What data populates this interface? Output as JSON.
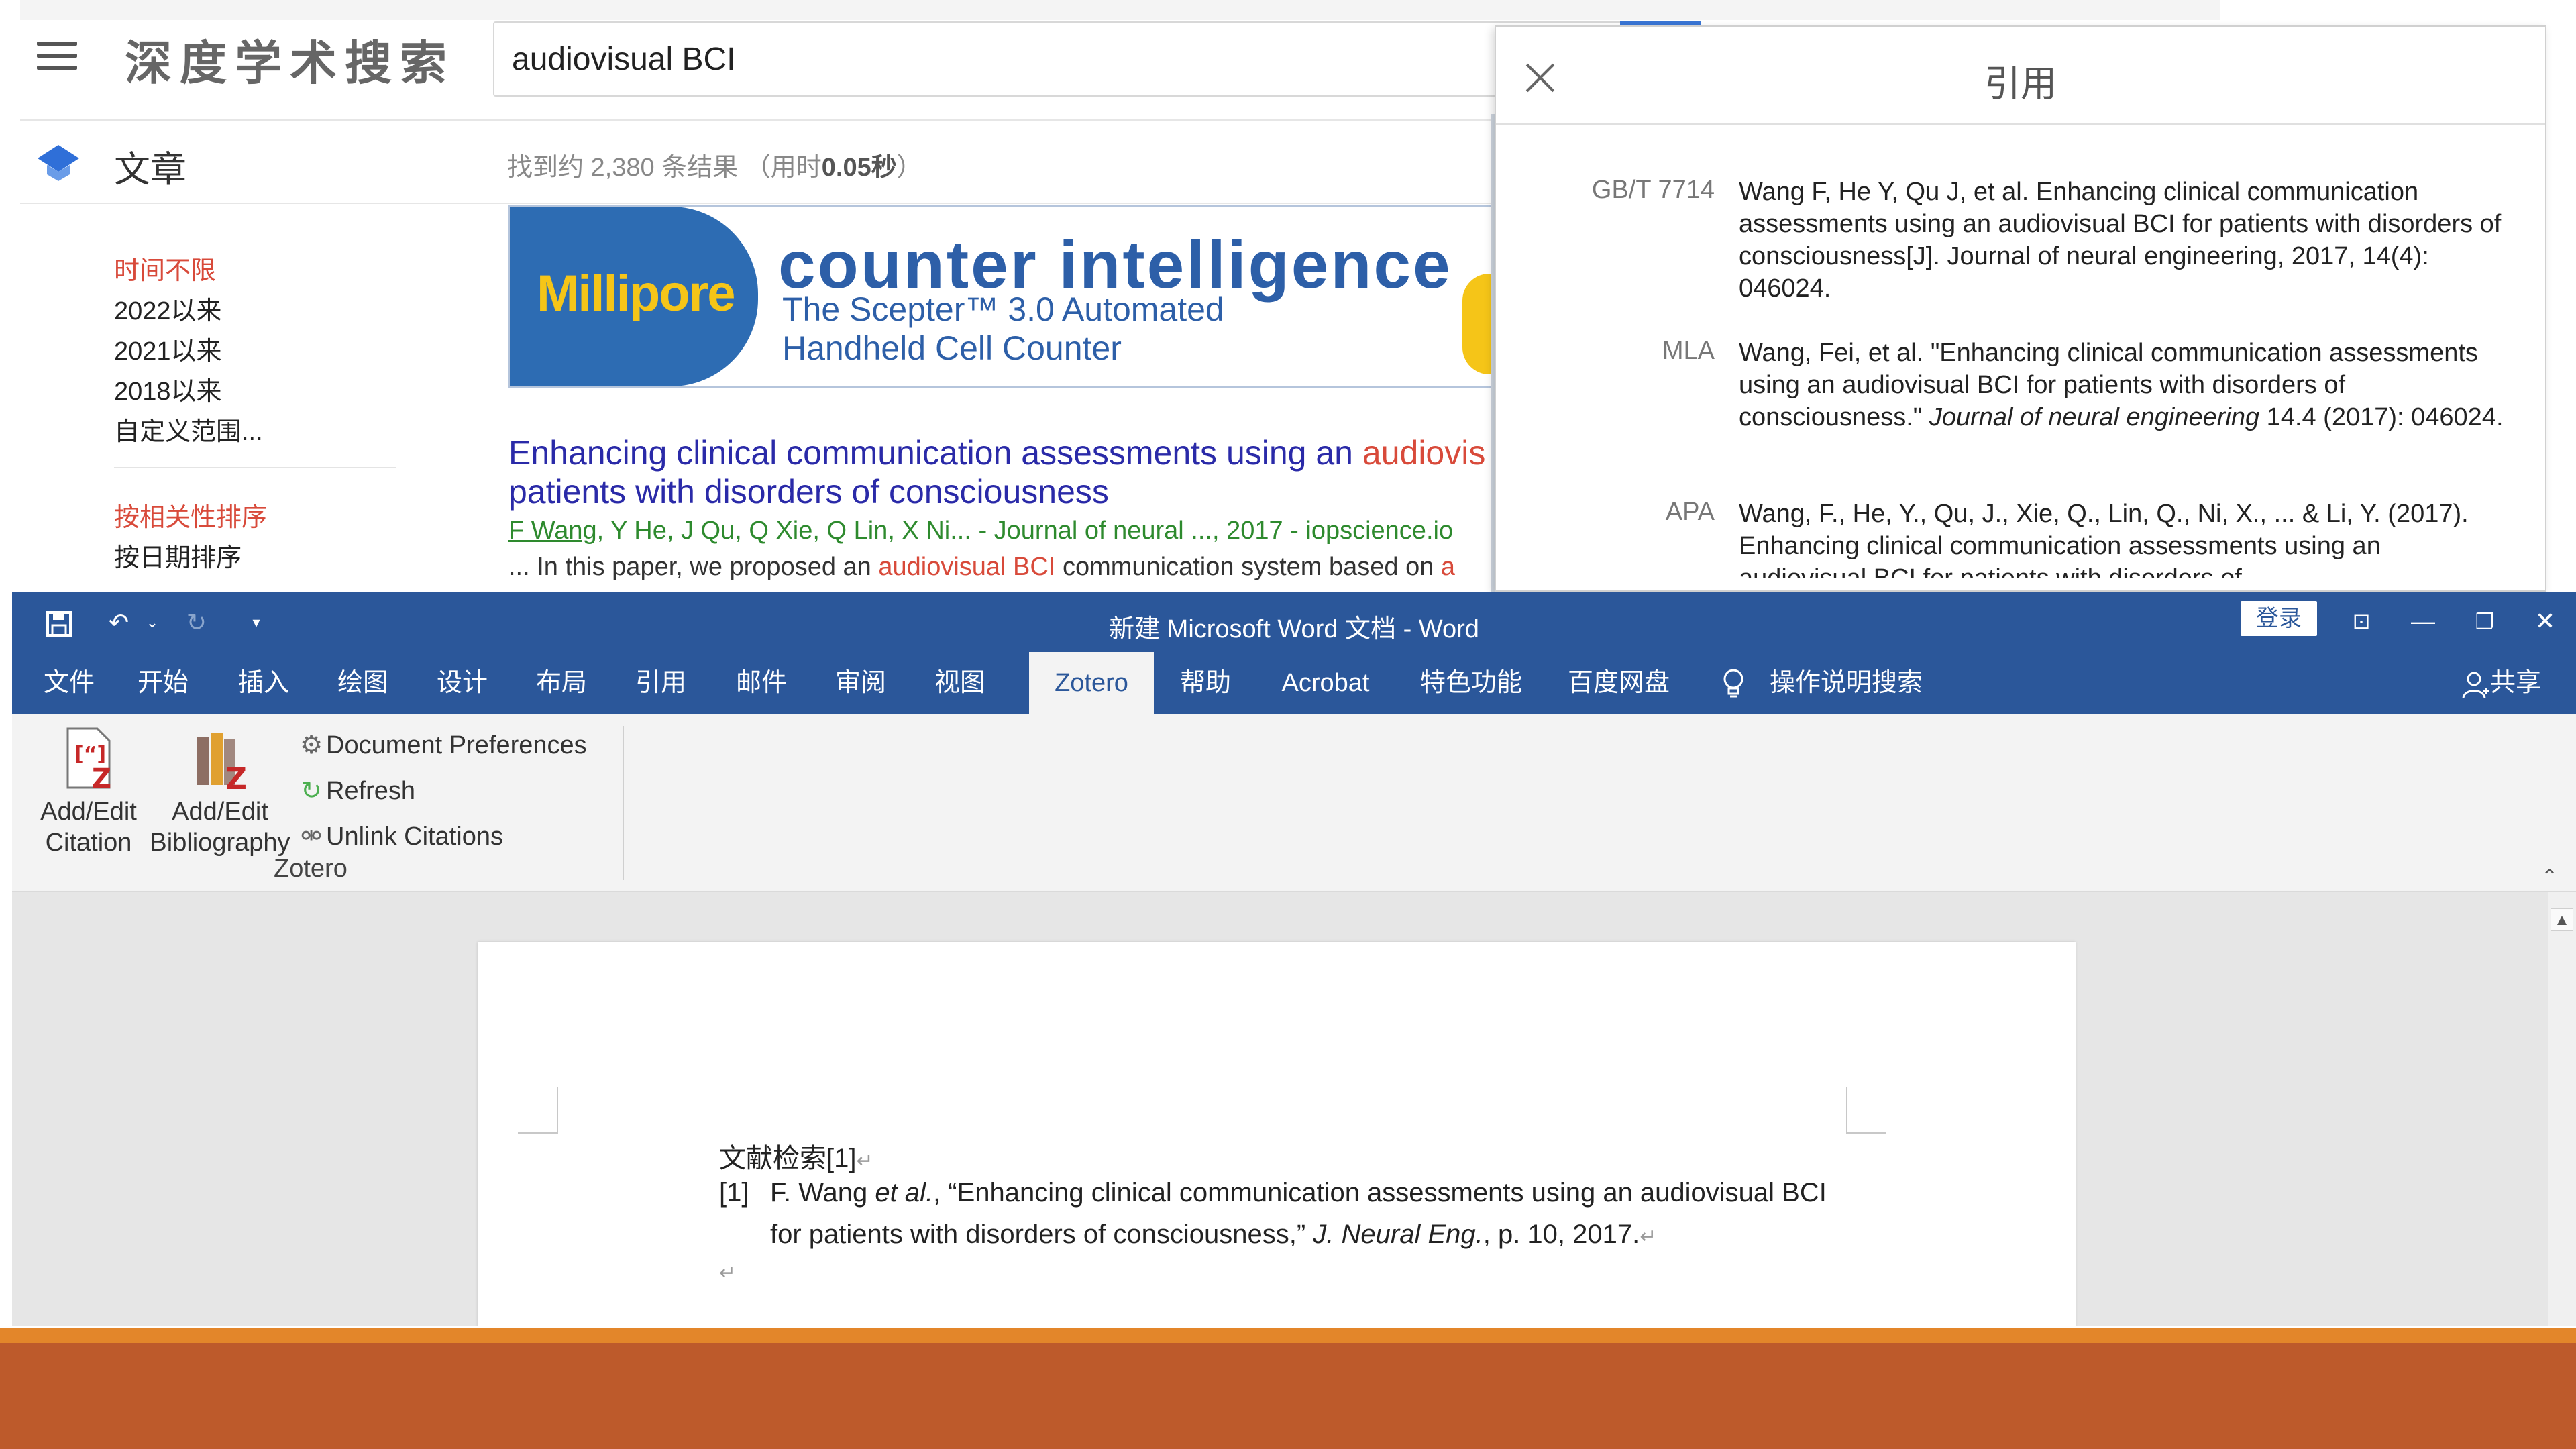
{
  "baidu": {
    "logo": "深度学术搜索",
    "search_value": "audiovisual BCI",
    "tab_article": "文章",
    "result_count_prefix": "找到约 2,380 条结果 （用时",
    "result_time": "0.05秒",
    "result_count_suffix": "）",
    "time_filters": [
      "时间不限",
      "2022以来",
      "2021以来",
      "2018以来",
      "自定义范围..."
    ],
    "sort_options": [
      "按相关性排序",
      "按日期排序"
    ],
    "ad": {
      "brand": "Millipore",
      "title": "counter intelligence",
      "subtitle_1": "The Scepter™ 3.0 Automated",
      "subtitle_2": "Handheld Cell Counter"
    },
    "result": {
      "title_part1": "Enhancing clinical communication assessments using an ",
      "title_highlight": "audiovis",
      "title_part2": "patients with disorders of consciousness",
      "meta_author": "F Wang",
      "meta_rest": ", Y He, J Qu, Q Xie, Q Lin, X Ni... - Journal of neural ..., 2017 - iopscience.io",
      "snippet_part1": "... In this paper, we proposed an ",
      "snippet_highlight": "audiovisual BCI",
      "snippet_part2": " communication system based on ",
      "snippet_tail": "a"
    },
    "accent_color": "#d84a3a",
    "link_color": "#2a2aa8"
  },
  "citation_panel": {
    "title": "引用",
    "entries": [
      {
        "format": "GB/T 7714",
        "text": "Wang F, He Y, Qu J, et al. Enhancing clinical communication assessments using an audiovisual BCI for patients with disorders of consciousness[J]. Journal of neural engineering, 2017, 14(4): 046024."
      },
      {
        "format": "MLA",
        "text_before": "Wang, Fei, et al. \"Enhancing clinical communication assessments using an audiovisual BCI for patients with disorders of consciousness.\" ",
        "text_italic": "Journal of neural engineering",
        "text_after": " 14.4 (2017): 046024."
      },
      {
        "format": "APA",
        "text": "Wang, F., He, Y., Qu, J., Xie, Q., Lin, Q., Ni, X., ... & Li, Y. (2017). Enhancing clinical communication assessments using an audiovisual BCI for patients with disorders of"
      }
    ]
  },
  "word": {
    "title": "新建 Microsoft Word 文档  -  Word",
    "login": "登录",
    "tabs": [
      "文件",
      "开始",
      "插入",
      "绘图",
      "设计",
      "布局",
      "引用",
      "邮件",
      "审阅",
      "视图",
      "Zotero",
      "帮助",
      "Acrobat",
      "特色功能",
      "百度网盘"
    ],
    "active_tab": "Zotero",
    "tell_me": "操作说明搜索",
    "share": "共享",
    "ribbon": {
      "add_citation_1": "Add/Edit",
      "add_citation_2": "Citation",
      "add_bib_1": "Add/Edit",
      "add_bib_2": "Bibliography",
      "doc_prefs": "Document Preferences",
      "refresh": "Refresh",
      "unlink": "Unlink Citations",
      "group": "Zotero"
    },
    "document": {
      "heading": "文献检索[1]",
      "ref_num": "[1]",
      "ref_line1_before": "F. Wang ",
      "ref_line1_italic": "et al.",
      "ref_line1_after": ", “Enhancing clinical communication assessments using an audiovisual BCI",
      "ref_line2_before": "for patients with disorders of consciousness,” ",
      "ref_line2_italic": "J. Neural Eng.",
      "ref_line2_after": ", p. 10, 2017."
    },
    "theme_color": "#2b579a"
  },
  "slide": {
    "bar_color_1": "#e3862a",
    "bar_color_2": "#bd5a2b"
  }
}
